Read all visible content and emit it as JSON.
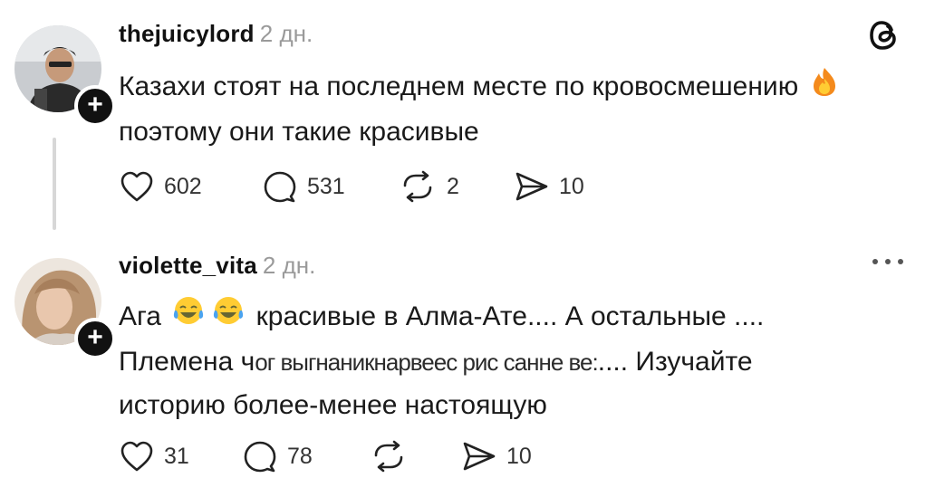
{
  "posts": [
    {
      "username": "thejuicylord",
      "time": "2 дн.",
      "lines": [
        "Казахи стоят на последнем месте по кровосмешению",
        "поэтому они такие красивые"
      ],
      "emoji": "fire-emoji",
      "stats": {
        "likes": "602",
        "replies": "531",
        "reposts": "2",
        "shares": "10"
      }
    },
    {
      "username": "violette_vita",
      "time": "2 дн.",
      "line1_pre": "Ага",
      "line1_post": "красивые в Алма-Ате.... А остальные ....",
      "line2_pre": "Племена ч",
      "line2_garbled": "ог выгнаникнарвеес рис санне ве:",
      "line2_post": ".... Изучайте",
      "line3": "историю более-менее настоящую",
      "emoji": "tears-of-joy-emoji",
      "stats": {
        "likes": "31",
        "replies": "78",
        "reposts": "",
        "shares": "10"
      }
    }
  ],
  "icons": {
    "threads": "threads-logo-icon",
    "more": "more-options-icon",
    "like": "heart-icon",
    "reply": "comment-icon",
    "repost": "repost-icon",
    "share": "share-icon"
  }
}
